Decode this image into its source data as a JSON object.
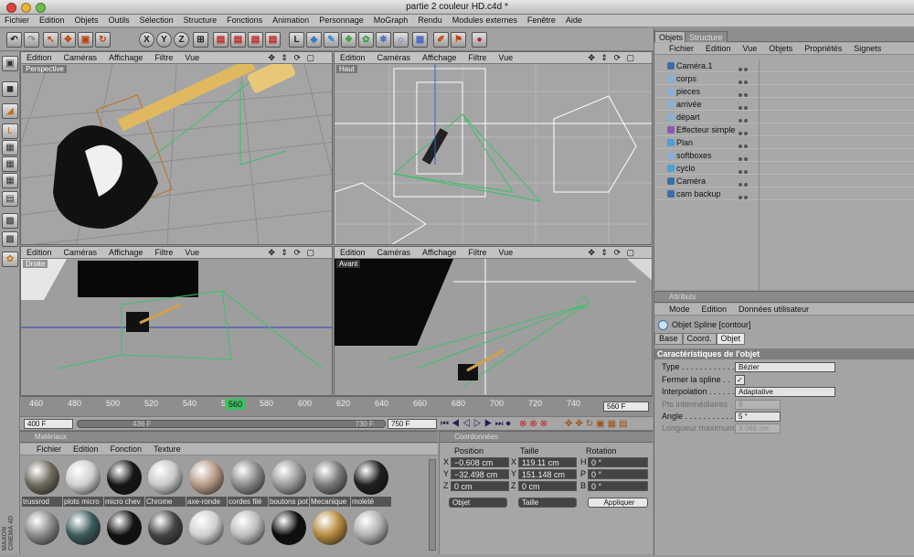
{
  "window": {
    "title": "partie 2 couleur HD.c4d *"
  },
  "menubar": [
    "Fichier",
    "Edition",
    "Objets",
    "Outils",
    "Sélection",
    "Structure",
    "Fonctions",
    "Animation",
    "Personnage",
    "MoGraph",
    "Rendu",
    "Modules externes",
    "Fenêtre",
    "Aide"
  ],
  "viewport_menu": [
    "Edition",
    "Caméras",
    "Affichage",
    "Filtre",
    "Vue"
  ],
  "viewports": {
    "perspective": "Perspective",
    "top": "Haut",
    "right": "Droite",
    "front": "Avant"
  },
  "viewport_nav": "✥ ⇕ ⟳ ▢",
  "timeline": {
    "ticks": [
      "460",
      "480",
      "500",
      "520",
      "540",
      "560",
      "580",
      "600",
      "620",
      "640",
      "660",
      "680",
      "700",
      "720",
      "740"
    ],
    "current": "560",
    "end_frame": "560 F"
  },
  "playbar": {
    "start": "400 F",
    "range_start": "436 F",
    "range_end": "730 F",
    "end": "750 F"
  },
  "materials": {
    "header": "Matériaux",
    "menu": [
      "Fichier",
      "Edition",
      "Fonction",
      "Texture"
    ],
    "row1": [
      {
        "name": "trussrod",
        "color": "#6e6a5c"
      },
      {
        "name": "plots micro",
        "color": "#d0d0d0"
      },
      {
        "name": "micro chev",
        "color": "#151515"
      },
      {
        "name": "Chrome",
        "color": "#c8c8c8"
      },
      {
        "name": "axe-ronde",
        "color": "#b59a86"
      },
      {
        "name": "cordes filé",
        "color": "#8a8a8a"
      },
      {
        "name": "boutons pot",
        "color": "#9a9a9a"
      },
      {
        "name": "Mecanique",
        "color": "#7a7a7a"
      },
      {
        "name": "moleté",
        "color": "#1e1e1e"
      }
    ],
    "row2": [
      {
        "name": "",
        "color": "#8a8a8a"
      },
      {
        "name": "",
        "color": "#3c5a5c"
      },
      {
        "name": "",
        "color": "#111111"
      },
      {
        "name": "",
        "color": "#444444"
      },
      {
        "name": "",
        "color": "#cfcfcf"
      },
      {
        "name": "",
        "color": "#bdbdbd"
      },
      {
        "name": "",
        "color": "#0e0e0e"
      },
      {
        "name": "",
        "color": "#b58a3e"
      },
      {
        "name": "",
        "color": "#b0b0b0"
      }
    ]
  },
  "coords": {
    "header": "Coordonnées",
    "col_position": "Position",
    "col_size": "Taille",
    "col_rotation": "Rotation",
    "rows": [
      {
        "a": "X",
        "pos": "−0.608 cm",
        "s": "X",
        "size": "119.11 cm",
        "r": "H",
        "rot": "0 °"
      },
      {
        "a": "Y",
        "pos": "−32.498 cm",
        "s": "Y",
        "size": "151.148 cm",
        "r": "P",
        "rot": "0 °"
      },
      {
        "a": "Z",
        "pos": "0 cm",
        "s": "Z",
        "size": "0 cm",
        "r": "B",
        "rot": "0 °"
      }
    ],
    "mode": "Objet",
    "size_mode": "Taille",
    "apply": "Appliquer"
  },
  "objects": {
    "tab_objects": "Objets",
    "tab_structure": "Structure",
    "menu": [
      "Fichier",
      "Edition",
      "Vue",
      "Objets",
      "Propriétés",
      "Signets"
    ],
    "items": [
      {
        "name": "Caméra.1",
        "color": "#3a6ea8"
      },
      {
        "name": "corps",
        "color": "#8ab0d8"
      },
      {
        "name": "pieces",
        "color": "#8ab0d8"
      },
      {
        "name": "arrivée",
        "color": "#8ab0d8"
      },
      {
        "name": "départ",
        "color": "#8ab0d8"
      },
      {
        "name": "Effecteur simple",
        "color": "#8a5ab0"
      },
      {
        "name": "Plan",
        "color": "#4aa0d8"
      },
      {
        "name": "softboxes",
        "color": "#8ab0d8"
      },
      {
        "name": "cyclo",
        "color": "#4aa0d8"
      },
      {
        "name": "Caméra",
        "color": "#3a6ea8"
      },
      {
        "name": "cam backup",
        "color": "#3a6ea8"
      }
    ]
  },
  "attributes": {
    "header": "Attributs",
    "menu": [
      "Mode",
      "Edition",
      "Données utilisateur"
    ],
    "object": "Objet Spline [contour]",
    "tabs": [
      "Base",
      "Coord.",
      "Objet"
    ],
    "section": "Caractéristiques de l'objet",
    "type_label": "Type . . . . . . . . . . . . . .",
    "type_value": "Bézier",
    "close_label": "Fermer la spline . .",
    "close_value": "✓",
    "interp_label": "Interpolation . . . . . .",
    "interp_value": "Adaptative",
    "pts_label": "Pts intermédiaires . .",
    "pts_value": "8",
    "angle_label": "Angle . . . . . . . . . . . .",
    "angle_value": "5 °",
    "maxlen_label": "Longueur maximum",
    "maxlen_value": "3.066 cm"
  },
  "brand": "MAXON CINEMA 4D"
}
